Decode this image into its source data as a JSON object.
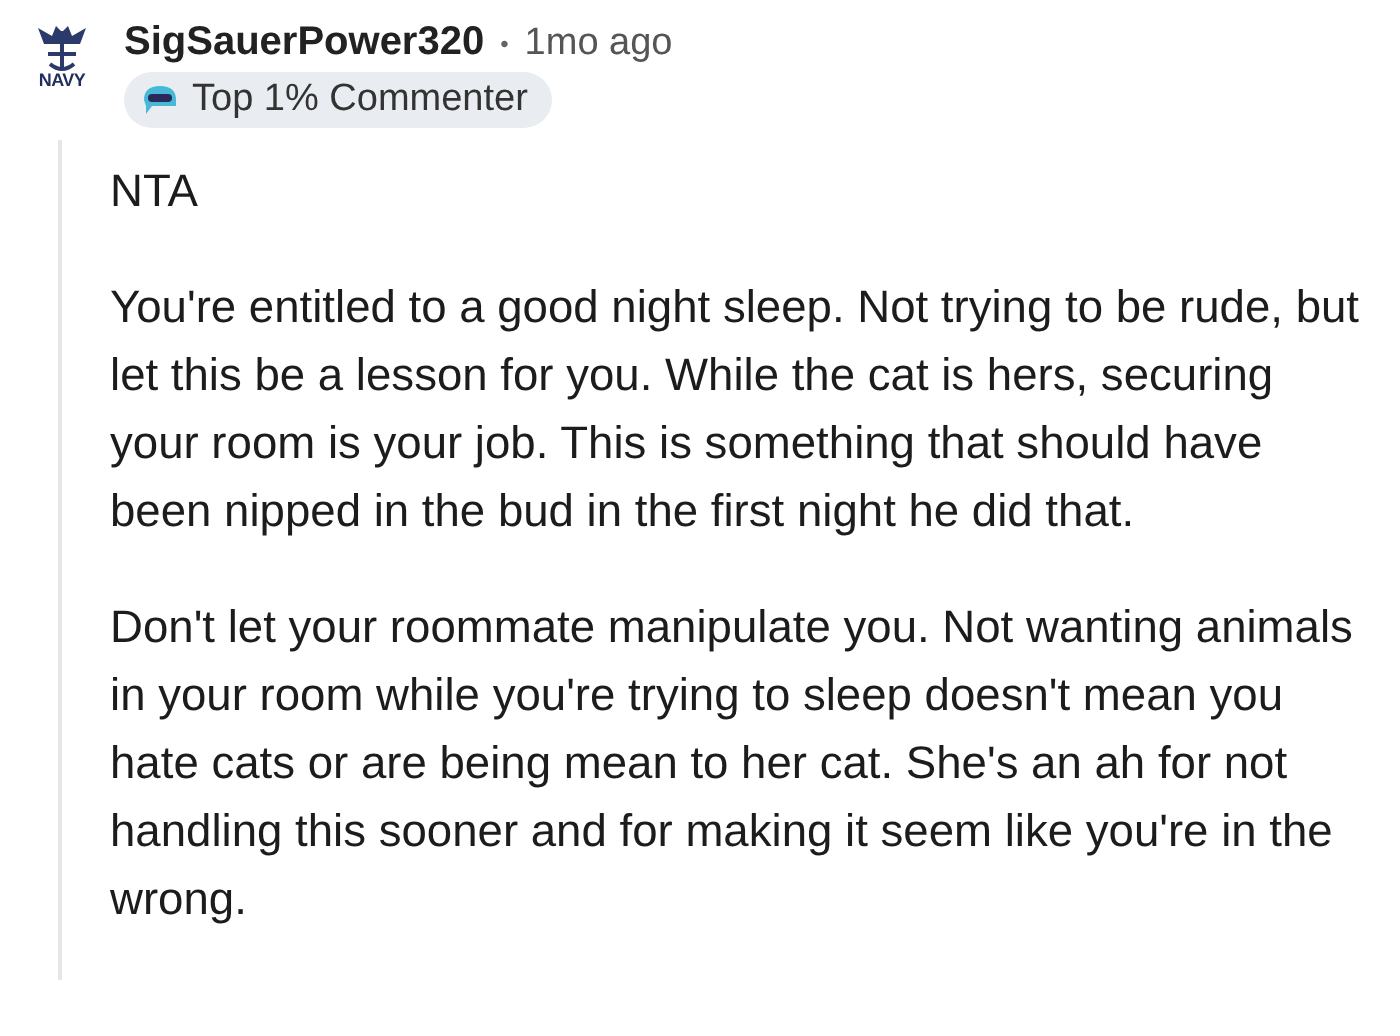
{
  "comment": {
    "avatar": {
      "label": "NAVY"
    },
    "author": "SigSauerPower320",
    "separator": "•",
    "time": "1mo ago",
    "badge": "Top 1% Commenter",
    "paragraphs": [
      "NTA",
      "You're entitled to a good night sleep. Not trying to be rude, but let this be a lesson for you. While the cat is hers, securing your room is your job. This is something that should have been nipped in the bud in the first night he did that.",
      "Don't let your roommate manipulate you. Not wanting animals in your room while you're trying to sleep doesn't mean you hate cats or are being mean to her cat. She's an ah for not handling this sooner and for making it seem like you're in the wrong."
    ]
  }
}
